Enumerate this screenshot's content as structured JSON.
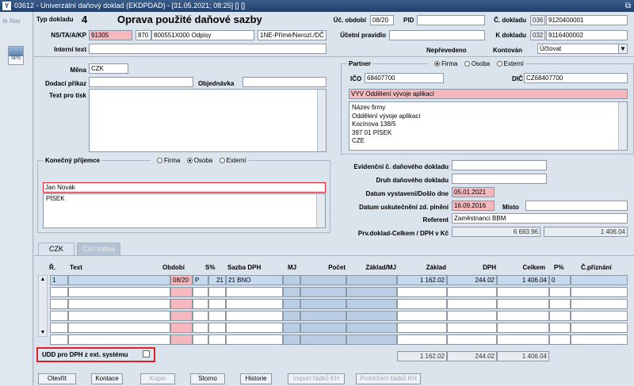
{
  "window": {
    "title": "03612 - Univerzální daňový doklad (EKDPDAD) - [31.05.2021; 08:25] [] []",
    "logo": "Y",
    "max_icon": "⧉"
  },
  "left": {
    "nav_label": "Nav",
    "sps_label": "SPS"
  },
  "header": {
    "typ_label": "Typ dokladu",
    "typ_value": "4",
    "title": "Oprava použité daňové sazby",
    "ns_label": "NS/TA/A/KP",
    "ns_value": "91305",
    "ta_code": "870",
    "ta_text": "800551X000 Odpisy",
    "kp_value": "1NE-Přímé/Nerozl./DČ",
    "interni_label": "Interní text",
    "interni_value": "",
    "uc_obdobi_label": "Úč. období",
    "uc_obdobi_value": "08/20",
    "pid_label": "PID",
    "pid_value": "",
    "cislo_label": "Č. dokladu",
    "cislo_prefix": "036",
    "cislo_value": "9120400001",
    "ucetni_label": "Účetní pravidlo",
    "ucetni_value": "",
    "k_label": "K dokladu",
    "k_prefix": "032",
    "k_value": "9116400002",
    "neprevedeno_label": "Nepřevedeno",
    "kontovan_label": "Kontován",
    "kontovan_value": "Účtovat",
    "kontovan_arrow": "▼"
  },
  "left_form": {
    "mena_label": "Měna",
    "mena_value": "CZK",
    "dodaci_label": "Dodací příkaz",
    "dodaci_value": "",
    "objednavka_label": "Objednávka",
    "objednavka_value": "",
    "text_tisk_label": "Text pro tisk",
    "text_tisk_value": ""
  },
  "partner": {
    "label": "Partner",
    "opt_firma": "Firma",
    "opt_osoba": "Osoba",
    "opt_externi": "Externí",
    "ico_label": "IČO",
    "ico_value": "68407700",
    "dic_label": "DIČ",
    "dic_value": "CZ68407700",
    "name": "VYV Oddělení vývoje aplikací",
    "address": [
      "Název firmy",
      "Oddělení vývoje aplikací",
      "Kocínova 138/5",
      "397 01 PÍSEK",
      "CZE"
    ]
  },
  "konecny": {
    "label": "Konečný příjemce",
    "opt_firma": "Firma",
    "opt_osoba": "Osoba",
    "opt_externi": "Externí",
    "name": "Jan Novák",
    "city": "PÍSEK"
  },
  "right_form": {
    "evid_label": "Evidenční č. daňového dokladu",
    "evid_value": "",
    "druh_label": "Druh daňového dokladu",
    "druh_value": "",
    "datum_vyst_label": "Datum vystavení/Došlo dne",
    "datum_vyst_value": "05.01.2021",
    "datum_usk_label": "Datum uskutečnění zd. plnění",
    "datum_usk_value": "16.09.2016",
    "misto_label": "Místo",
    "misto_value": "",
    "referent_label": "Referent",
    "referent_value": "Zaměstnanci BBM",
    "prv_label": "Prv.doklad-Celkem / DPH v Kč",
    "prv_celkem": "6 693.96",
    "prv_dph": "1 406.04"
  },
  "tabs": [
    {
      "label": "CZK"
    },
    {
      "label": "Cizí měna"
    }
  ],
  "grid": {
    "headers": {
      "r": "Ř.",
      "text": "Text",
      "obdobi": "Období",
      "s": "S%",
      "sazba": "Sazba DPH",
      "mj": "MJ",
      "pocet": "Počet",
      "zaklad_mj": "Základ/MJ",
      "zaklad": "Základ",
      "dph": "DPH",
      "celkem": "Celkem",
      "p": "P%",
      "cpriz": "Č.přiznání"
    },
    "row1": {
      "r": "1",
      "text": "",
      "obdobi": "08/20",
      "s": "P",
      "sazba_code": "21",
      "sazba_text": "21 BNO",
      "mj": "",
      "pocet": "",
      "zaklad_mj": "",
      "zaklad": "1 162.02",
      "dph": "244.02",
      "celkem": "1 406.04",
      "p": "0",
      "cpriz": ""
    },
    "totals": {
      "zaklad": "1 162.02",
      "dph": "244.02",
      "celkem": "1 406.04"
    },
    "scroll_up": "▲",
    "scroll_down": "▼"
  },
  "udd": {
    "label": "UDD pro DPH z ext. systému"
  },
  "buttons": {
    "otevrit": "Otevřít",
    "kontace": "Kontace",
    "kopie": "Kopie",
    "storno": "Storno",
    "historie": "Historie",
    "import": "Import řádků KH",
    "prohlizeni": "Prohlížení řádků KH"
  },
  "colors": {
    "title_bar": "#22406b",
    "mandatory": "#f4b8bd",
    "highlight": "#e0212a",
    "selected_row": "#c6d9ef"
  }
}
